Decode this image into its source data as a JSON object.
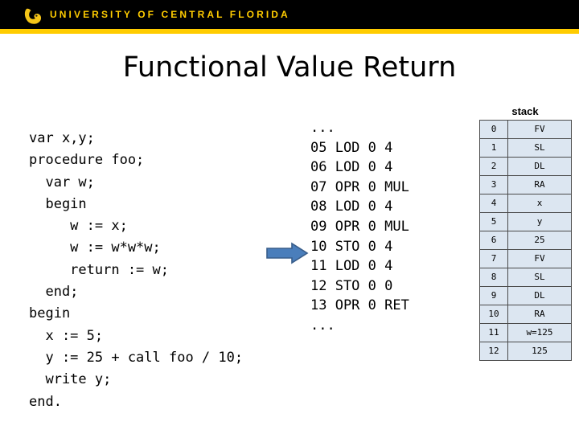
{
  "header": {
    "university_name": "UNIVERSITY OF CENTRAL FLORIDA",
    "logo_icon": "ucf-pegasus-icon",
    "band_color": "#000000",
    "stripe_color": "#FFCC00",
    "text_color": "#FFCC00"
  },
  "slide": {
    "title": "Functional Value Return"
  },
  "source_code": {
    "language": "PL/0",
    "text": "var x,y;\nprocedure foo;\n  var w;\n  begin\n     w := x;\n     w := w*w*w;\n     return := w;\n  end;\nbegin\n  x := 5;\n  y := 25 + call foo / 10;\n  write y;\nend.",
    "lines": [
      "var x,y;",
      "procedure foo;",
      "  var w;",
      "  begin",
      "     w := x;",
      "     w := w*w*w;",
      "     return := w;",
      "  end;",
      "begin",
      "  x := 5;",
      "  y := 25 + call foo / 10;",
      "  write y;",
      "end."
    ]
  },
  "assembly_code": {
    "text": "...\n05 LOD 0 4\n06 LOD 0 4\n07 OPR 0 MUL\n08 LOD 0 4\n09 OPR 0 MUL\n10 STO 0 4\n11 LOD 0 4\n12 STO 0 0\n13 OPR 0 RET\n...",
    "ellipsis_top": "...",
    "ellipsis_bottom": "...",
    "instructions": [
      {
        "line": "05",
        "op": "LOD",
        "lexlevel": "0",
        "operand": "4"
      },
      {
        "line": "06",
        "op": "LOD",
        "lexlevel": "0",
        "operand": "4"
      },
      {
        "line": "07",
        "op": "OPR",
        "lexlevel": "0",
        "operand": "MUL"
      },
      {
        "line": "08",
        "op": "LOD",
        "lexlevel": "0",
        "operand": "4"
      },
      {
        "line": "09",
        "op": "OPR",
        "lexlevel": "0",
        "operand": "MUL"
      },
      {
        "line": "10",
        "op": "STO",
        "lexlevel": "0",
        "operand": "4"
      },
      {
        "line": "11",
        "op": "LOD",
        "lexlevel": "0",
        "operand": "4"
      },
      {
        "line": "12",
        "op": "STO",
        "lexlevel": "0",
        "operand": "0"
      },
      {
        "line": "13",
        "op": "OPR",
        "lexlevel": "0",
        "operand": "RET"
      }
    ]
  },
  "pointer": {
    "icon": "right-arrow-icon",
    "points_at_line": "11",
    "fill_color": "#4a7ebb",
    "stroke_color": "#385d8a"
  },
  "stack": {
    "caption": "stack",
    "cell_background": "#dce6f1",
    "border_color": "#4a4a4a",
    "rows": [
      {
        "index": "0",
        "value": "FV"
      },
      {
        "index": "1",
        "value": "SL"
      },
      {
        "index": "2",
        "value": "DL"
      },
      {
        "index": "3",
        "value": "RA"
      },
      {
        "index": "4",
        "value": "x"
      },
      {
        "index": "5",
        "value": "y"
      },
      {
        "index": "6",
        "value": "25"
      },
      {
        "index": "7",
        "value": "FV"
      },
      {
        "index": "8",
        "value": "SL"
      },
      {
        "index": "9",
        "value": "DL"
      },
      {
        "index": "10",
        "value": "RA"
      },
      {
        "index": "11",
        "value": "w=125"
      },
      {
        "index": "12",
        "value": "125"
      }
    ]
  }
}
